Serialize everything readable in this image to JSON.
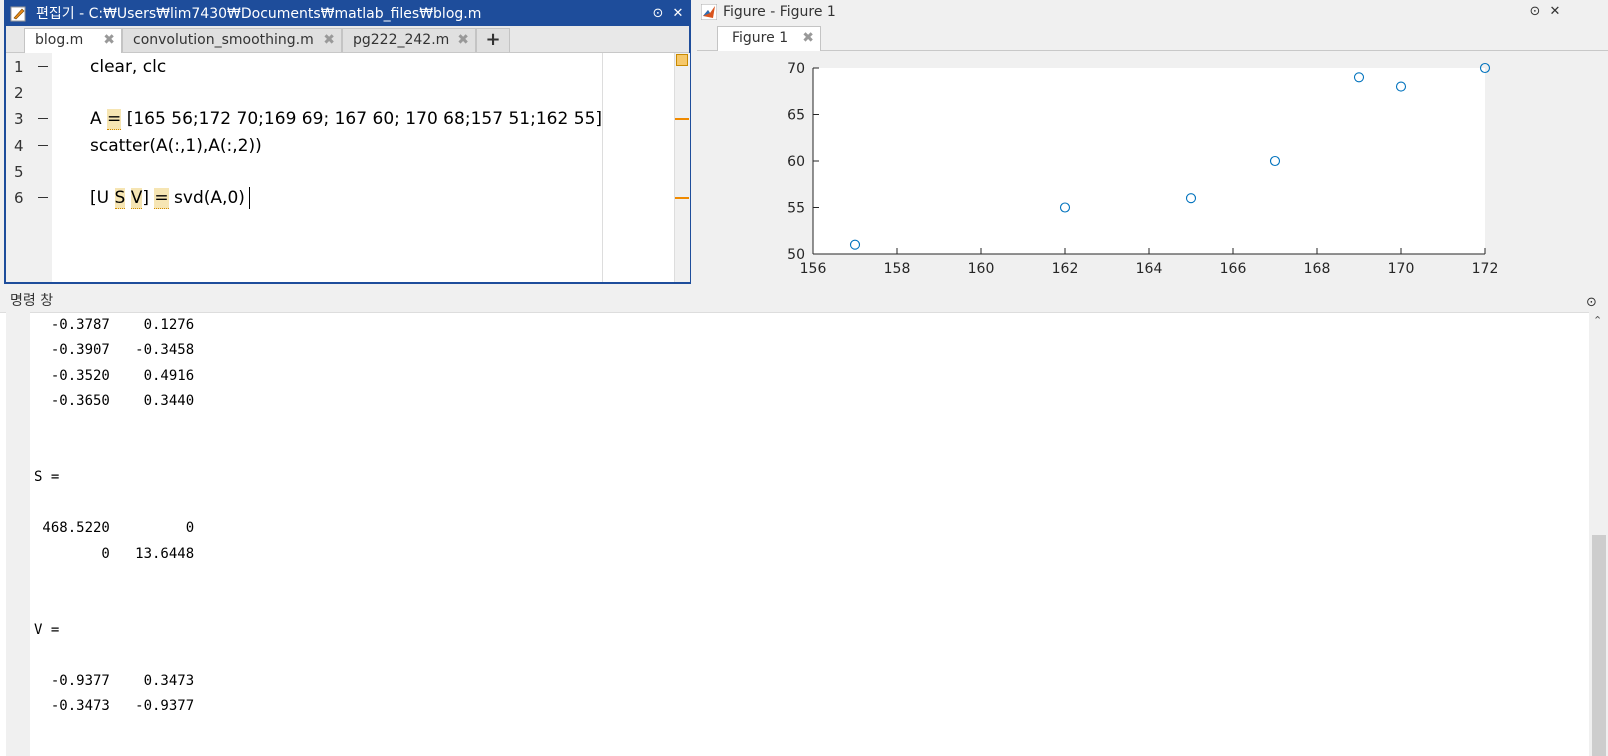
{
  "editor": {
    "title": "편집기 - C:₩Users₩lim7430₩Documents₩matlab_files₩blog.m",
    "tabs": [
      {
        "label": "blog.m"
      },
      {
        "label": "convolution_smoothing.m"
      },
      {
        "label": "pg222_242.m"
      }
    ],
    "add_tab": "+",
    "lines": [
      {
        "num": "1",
        "text": "clear, clc"
      },
      {
        "num": "2",
        "text": ""
      },
      {
        "num": "3",
        "text": "A = [165 56;172 70;169 69; 167 60; 170 68;157 51;162 55]"
      },
      {
        "num": "4",
        "text": "scatter(A(:,1),A(:,2))"
      },
      {
        "num": "5",
        "text": ""
      },
      {
        "num": "6",
        "text": "[U S V] = svd(A,0)"
      }
    ]
  },
  "figure": {
    "title": "Figure - Figure 1",
    "tab": "Figure 1"
  },
  "chart_data": {
    "type": "scatter",
    "x": [
      165,
      172,
      169,
      167,
      170,
      157,
      162
    ],
    "y": [
      56,
      70,
      69,
      60,
      68,
      51,
      55
    ],
    "xlim": [
      156,
      172
    ],
    "ylim": [
      50,
      70
    ],
    "xticks": [
      156,
      158,
      160,
      162,
      164,
      166,
      168,
      170,
      172
    ],
    "yticks": [
      50,
      55,
      60,
      65,
      70
    ],
    "marker_color": "#0072bd",
    "grid": false,
    "title": "",
    "xlabel": "",
    "ylabel": ""
  },
  "command_window": {
    "title": "명령 창",
    "lines": [
      "  -0.3787    0.1276",
      "  -0.3907   -0.3458",
      "  -0.3520    0.4916",
      "  -0.3650    0.3440",
      "",
      "",
      "S =",
      "",
      " 468.5220         0",
      "        0   13.6448",
      "",
      "",
      "V =",
      "",
      "  -0.9377    0.3473",
      "  -0.3473   -0.9377"
    ]
  },
  "colors": {
    "editor_title_bg": "#1e4d9b",
    "highlight": "#f6e5b3",
    "marker": "#0072bd"
  }
}
